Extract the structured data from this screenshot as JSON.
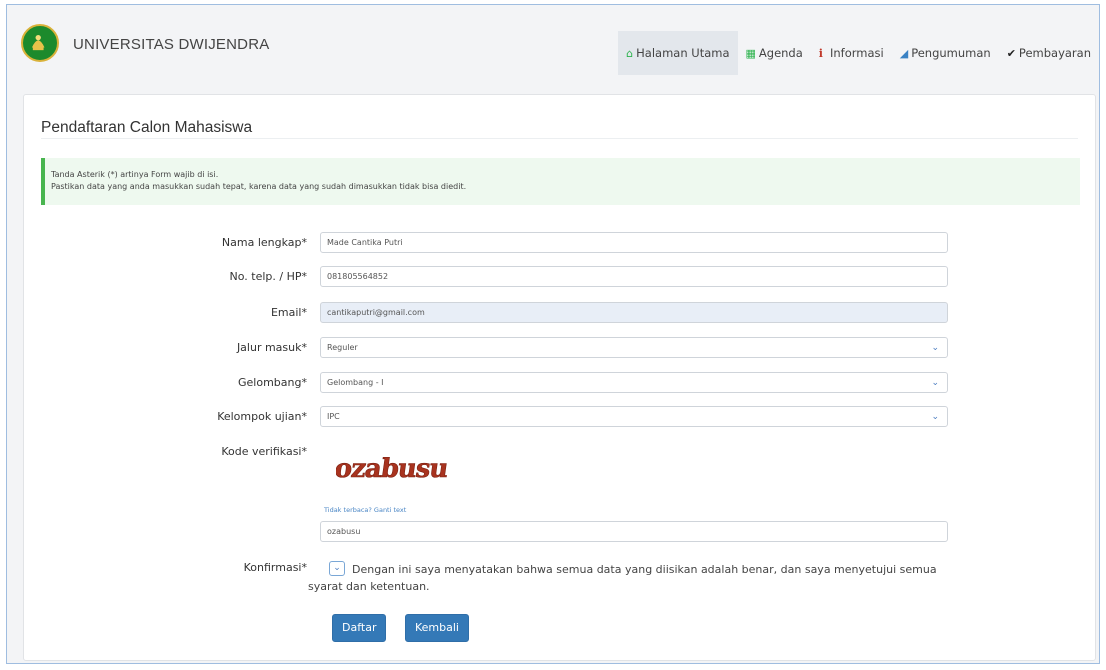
{
  "header": {
    "brand": "UNIVERSITAS DWIJENDRA",
    "nav": [
      {
        "label": "Halaman Utama",
        "icon": "home-icon"
      },
      {
        "label": "Agenda",
        "icon": "calendar-icon"
      },
      {
        "label": "Informasi",
        "icon": "info-icon"
      },
      {
        "label": "Pengumuman",
        "icon": "megaphone-icon"
      },
      {
        "label": "Pembayaran",
        "icon": "check-icon"
      }
    ]
  },
  "form": {
    "title": "Pendaftaran Calon Mahasiswa",
    "alert_line1": "Tanda Asterik (*) artinya Form wajib di isi.",
    "alert_line2": "Pastikan data yang anda masukkan sudah tepat, karena data yang sudah dimasukkan tidak bisa diedit.",
    "fields": {
      "nama": {
        "label": "Nama lengkap*",
        "value": "Made Cantika Putri"
      },
      "telp": {
        "label": "No. telp. / HP*",
        "value": "081805564852"
      },
      "email": {
        "label": "Email*",
        "value": "cantikaputri@gmail.com"
      },
      "jalur": {
        "label": "Jalur masuk*",
        "value": "Reguler"
      },
      "gelombang": {
        "label": "Gelombang*",
        "value": "Gelombang - I"
      },
      "kelompok": {
        "label": "Kelompok ujian*",
        "value": "IPC"
      },
      "kode": {
        "label": "Kode verifikasi*",
        "captcha_text": "ozabusu",
        "refresh_link": "Tidak terbaca? Ganti text",
        "value": "ozabusu"
      },
      "konfirmasi": {
        "label": "Konfirmasi*",
        "text": "Dengan ini saya menyatakan bahwa semua data yang diisikan adalah benar, dan saya menyetujui semua syarat dan ketentuan.",
        "checked": true
      }
    },
    "buttons": {
      "submit": "Daftar",
      "back": "Kembali"
    }
  },
  "colors": {
    "accent": "#3479b7",
    "alert_border": "#48b54f",
    "alert_bg": "#eef9ef",
    "captcha": "#a8331f"
  }
}
